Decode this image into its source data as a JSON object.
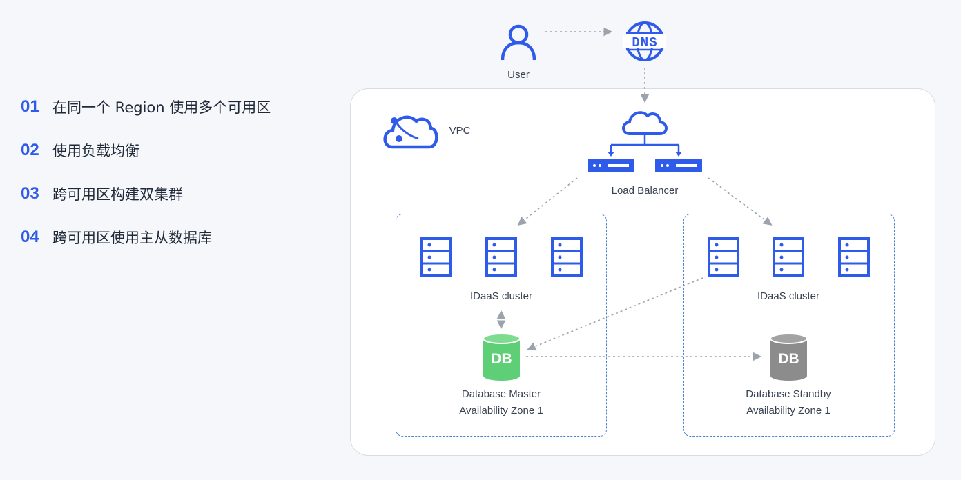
{
  "steps": [
    {
      "num": "01",
      "label": "在同一个 Region 使用多个可用区"
    },
    {
      "num": "02",
      "label": "使用负载均衡"
    },
    {
      "num": "03",
      "label": "跨可用区构建双集群"
    },
    {
      "num": "04",
      "label": "跨可用区使用主从数据库"
    }
  ],
  "diagram": {
    "user_label": "User",
    "dns_text": "DNS",
    "vpc_label": "VPC",
    "load_balancer_label": "Load Balancer",
    "left_cluster_label": "IDaaS cluster",
    "right_cluster_label": "IDaaS cluster",
    "db_text": "DB",
    "master_label": "Database Master",
    "master_zone": "Availability Zone 1",
    "standby_label": "Database Standby",
    "standby_zone": "Availability Zone 1"
  },
  "colors": {
    "accent": "#2f5bea",
    "db_master": "#5fcf77",
    "db_standby": "#8c8c8c",
    "connector": "#9ca3af",
    "zone_border": "#4a7fd1"
  },
  "icons": {
    "user": "user-icon",
    "dns": "dns-globe-icon",
    "vpc": "cloud-icon",
    "load_balancer": "load-balancer-icon",
    "server": "server-rack-icon",
    "database": "database-cylinder-icon"
  }
}
